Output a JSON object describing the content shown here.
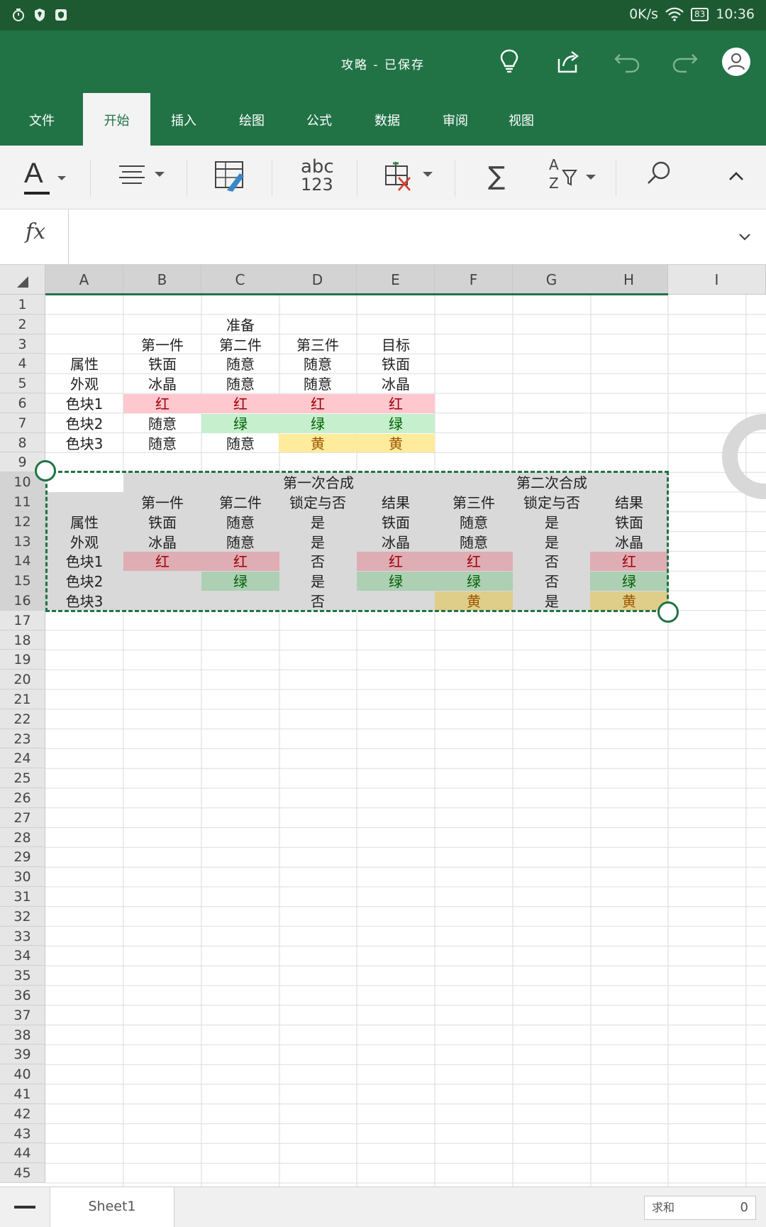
{
  "status_bar": {
    "net_speed": "0K/s",
    "battery": "83",
    "time": "10:36"
  },
  "title_bar": {
    "title": "攻略 - 已保存"
  },
  "tabs": [
    {
      "label": "文件",
      "active": false
    },
    {
      "label": "开始",
      "active": true
    },
    {
      "label": "插入",
      "active": false
    },
    {
      "label": "绘图",
      "active": false
    },
    {
      "label": "公式",
      "active": false
    },
    {
      "label": "数据",
      "active": false
    },
    {
      "label": "审阅",
      "active": false
    },
    {
      "label": "视图",
      "active": false
    }
  ],
  "toolbar": {
    "font_letter": "A",
    "number_format_top": "abc",
    "number_format_bottom": "123",
    "sum_symbol": "∑",
    "sort_label_a": "A",
    "sort_label_z": "Z"
  },
  "formula_bar": {
    "fx_label": "fx",
    "value": ""
  },
  "sheet": {
    "columns": [
      "A",
      "B",
      "C",
      "D",
      "E",
      "F",
      "G",
      "H",
      "I"
    ],
    "rows": [
      "1",
      "2",
      "3",
      "4",
      "5",
      "6",
      "7",
      "8",
      "9",
      "10",
      "11",
      "12",
      "13",
      "14",
      "15",
      "16",
      "17",
      "18",
      "19",
      "20",
      "21",
      "22",
      "23",
      "24",
      "25",
      "26",
      "27",
      "28",
      "29",
      "30",
      "31",
      "32",
      "33",
      "34",
      "35",
      "36",
      "37",
      "38",
      "39",
      "40",
      "41",
      "42",
      "43",
      "44",
      "45"
    ],
    "colors": {
      "red_fill": "#ffc7ce",
      "red_text": "#9c0006",
      "green_fill": "#c6efce",
      "green_text": "#006100",
      "yellow_fill": "#ffeb9c",
      "yellow_text": "#9c5700",
      "selection": "#217346"
    },
    "cells": [
      {
        "row": 2,
        "col": "C",
        "text": "准备"
      },
      {
        "row": 3,
        "col": "B",
        "text": "第一件"
      },
      {
        "row": 3,
        "col": "C",
        "text": "第二件"
      },
      {
        "row": 3,
        "col": "D",
        "text": "第三件"
      },
      {
        "row": 3,
        "col": "E",
        "text": "目标"
      },
      {
        "row": 4,
        "col": "A",
        "text": "属性"
      },
      {
        "row": 4,
        "col": "B",
        "text": "铁面"
      },
      {
        "row": 4,
        "col": "C",
        "text": "随意"
      },
      {
        "row": 4,
        "col": "D",
        "text": "随意"
      },
      {
        "row": 4,
        "col": "E",
        "text": "铁面"
      },
      {
        "row": 5,
        "col": "A",
        "text": "外观"
      },
      {
        "row": 5,
        "col": "B",
        "text": "冰晶"
      },
      {
        "row": 5,
        "col": "C",
        "text": "随意"
      },
      {
        "row": 5,
        "col": "D",
        "text": "随意"
      },
      {
        "row": 5,
        "col": "E",
        "text": "冰晶"
      },
      {
        "row": 6,
        "col": "A",
        "text": "色块1"
      },
      {
        "row": 6,
        "col": "B",
        "text": "红",
        "style": "red"
      },
      {
        "row": 6,
        "col": "C",
        "text": "红",
        "style": "red"
      },
      {
        "row": 6,
        "col": "D",
        "text": "红",
        "style": "red"
      },
      {
        "row": 6,
        "col": "E",
        "text": "红",
        "style": "red"
      },
      {
        "row": 7,
        "col": "A",
        "text": "色块2"
      },
      {
        "row": 7,
        "col": "B",
        "text": "随意"
      },
      {
        "row": 7,
        "col": "C",
        "text": "绿",
        "style": "green"
      },
      {
        "row": 7,
        "col": "D",
        "text": "绿",
        "style": "green"
      },
      {
        "row": 7,
        "col": "E",
        "text": "绿",
        "style": "green"
      },
      {
        "row": 8,
        "col": "A",
        "text": "色块3"
      },
      {
        "row": 8,
        "col": "B",
        "text": "随意"
      },
      {
        "row": 8,
        "col": "C",
        "text": "随意"
      },
      {
        "row": 8,
        "col": "D",
        "text": "黄",
        "style": "yellow"
      },
      {
        "row": 8,
        "col": "E",
        "text": "黄",
        "style": "yellow"
      },
      {
        "row": 10,
        "col": "C",
        "span": 3,
        "text": "第一次合成"
      },
      {
        "row": 10,
        "col": "F",
        "span": 3,
        "text": "第二次合成"
      },
      {
        "row": 11,
        "col": "B",
        "text": "第一件"
      },
      {
        "row": 11,
        "col": "C",
        "text": "第二件"
      },
      {
        "row": 11,
        "col": "D",
        "text": "锁定与否"
      },
      {
        "row": 11,
        "col": "E",
        "text": "结果"
      },
      {
        "row": 11,
        "col": "F",
        "text": "第三件"
      },
      {
        "row": 11,
        "col": "G",
        "text": "锁定与否"
      },
      {
        "row": 11,
        "col": "H",
        "text": "结果"
      },
      {
        "row": 12,
        "col": "A",
        "text": "属性"
      },
      {
        "row": 12,
        "col": "B",
        "text": "铁面"
      },
      {
        "row": 12,
        "col": "C",
        "text": "随意"
      },
      {
        "row": 12,
        "col": "D",
        "text": "是"
      },
      {
        "row": 12,
        "col": "E",
        "text": "铁面"
      },
      {
        "row": 12,
        "col": "F",
        "text": "随意"
      },
      {
        "row": 12,
        "col": "G",
        "text": "是"
      },
      {
        "row": 12,
        "col": "H",
        "text": "铁面"
      },
      {
        "row": 13,
        "col": "A",
        "text": "外观"
      },
      {
        "row": 13,
        "col": "B",
        "text": "冰晶"
      },
      {
        "row": 13,
        "col": "C",
        "text": "随意"
      },
      {
        "row": 13,
        "col": "D",
        "text": "是"
      },
      {
        "row": 13,
        "col": "E",
        "text": "冰晶"
      },
      {
        "row": 13,
        "col": "F",
        "text": "随意"
      },
      {
        "row": 13,
        "col": "G",
        "text": "是"
      },
      {
        "row": 13,
        "col": "H",
        "text": "冰晶"
      },
      {
        "row": 14,
        "col": "A",
        "text": "色块1"
      },
      {
        "row": 14,
        "col": "B",
        "text": "红",
        "style": "red"
      },
      {
        "row": 14,
        "col": "C",
        "text": "红",
        "style": "red"
      },
      {
        "row": 14,
        "col": "D",
        "text": "否"
      },
      {
        "row": 14,
        "col": "E",
        "text": "红",
        "style": "red"
      },
      {
        "row": 14,
        "col": "F",
        "text": "红",
        "style": "red"
      },
      {
        "row": 14,
        "col": "G",
        "text": "否"
      },
      {
        "row": 14,
        "col": "H",
        "text": "红",
        "style": "red"
      },
      {
        "row": 15,
        "col": "A",
        "text": "色块2"
      },
      {
        "row": 15,
        "col": "C",
        "text": "绿",
        "style": "green"
      },
      {
        "row": 15,
        "col": "D",
        "text": "是"
      },
      {
        "row": 15,
        "col": "E",
        "text": "绿",
        "style": "green"
      },
      {
        "row": 15,
        "col": "F",
        "text": "绿",
        "style": "green"
      },
      {
        "row": 15,
        "col": "G",
        "text": "否"
      },
      {
        "row": 15,
        "col": "H",
        "text": "绿",
        "style": "green"
      },
      {
        "row": 16,
        "col": "A",
        "text": "色块3"
      },
      {
        "row": 16,
        "col": "D",
        "text": "否"
      },
      {
        "row": 16,
        "col": "F",
        "text": "黄",
        "style": "yellow"
      },
      {
        "row": 16,
        "col": "G",
        "text": "是"
      },
      {
        "row": 16,
        "col": "H",
        "text": "黄",
        "style": "yellow"
      }
    ],
    "selected_range": {
      "from": "A10",
      "to": "H16"
    }
  },
  "sheet_bar": {
    "sheet_name": "Sheet1",
    "sum_label": "求和",
    "sum_value": "0"
  }
}
